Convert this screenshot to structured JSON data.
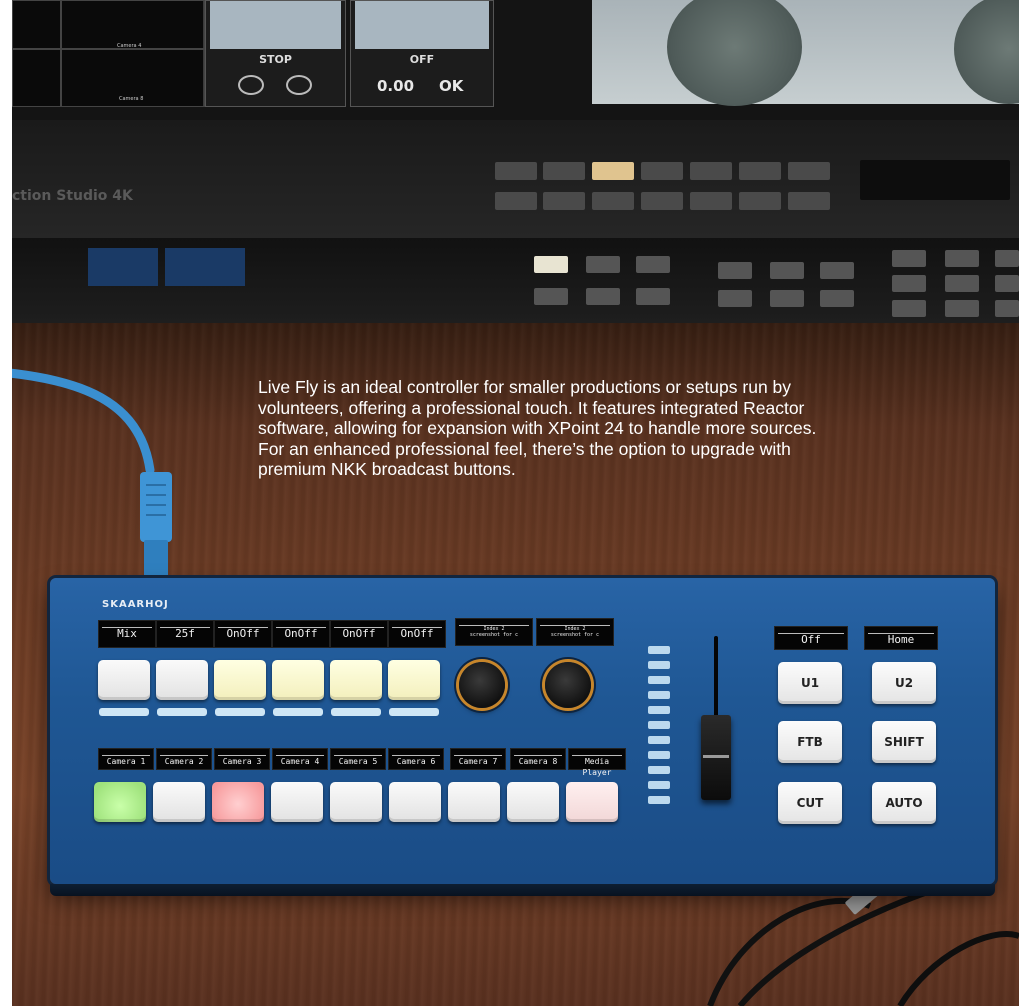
{
  "background_monitor": {
    "cell_labels": [
      "Camera 4",
      "Camera 8"
    ],
    "panel_stop": "STOP",
    "panel_off": "OFF",
    "value": "0.00",
    "status": "OK",
    "studio_label": "ction Studio 4K"
  },
  "caption": "Live Fly is an ideal controller for smaller productions or setups run by volunteers, offering a professional touch. It features integrated Reactor software, allowing for expansion with XPoint 24 to handle more sources. For an enhanced professional feel, there’s the option to upgrade with premium NKK broadcast buttons.",
  "controller": {
    "brand": "SKAARHOJ",
    "top_displays": [
      {
        "value": "Mix"
      },
      {
        "value": "25f"
      },
      {
        "value": "OnOff"
      },
      {
        "value": "OnOff"
      },
      {
        "value": "OnOff"
      },
      {
        "value": "OnOff"
      }
    ],
    "knob_displays": [
      {
        "value": "Index 2\nscreenshot for c"
      },
      {
        "value": "Index 2\nscreenshot for c"
      }
    ],
    "source_displays": [
      {
        "value": "Camera 1"
      },
      {
        "value": "Camera 2"
      },
      {
        "value": "Camera 3"
      },
      {
        "value": "Camera 4"
      },
      {
        "value": "Camera 5"
      },
      {
        "value": "Camera 6"
      },
      {
        "value": "Camera 7"
      },
      {
        "value": "Camera 8"
      },
      {
        "value": "Media Player"
      }
    ],
    "right_displays": [
      {
        "value": "Off"
      },
      {
        "value": "Home"
      }
    ],
    "function_keys": {
      "u1": "U1",
      "u2": "U2",
      "ftb": "FTB",
      "shift": "SHIFT",
      "cut": "CUT",
      "auto": "AUTO"
    },
    "key_colors": {
      "program": "#9fe27c",
      "preview": "#f79a9c",
      "panel": "#1f5794",
      "knob_ring": "#c7862b"
    }
  }
}
